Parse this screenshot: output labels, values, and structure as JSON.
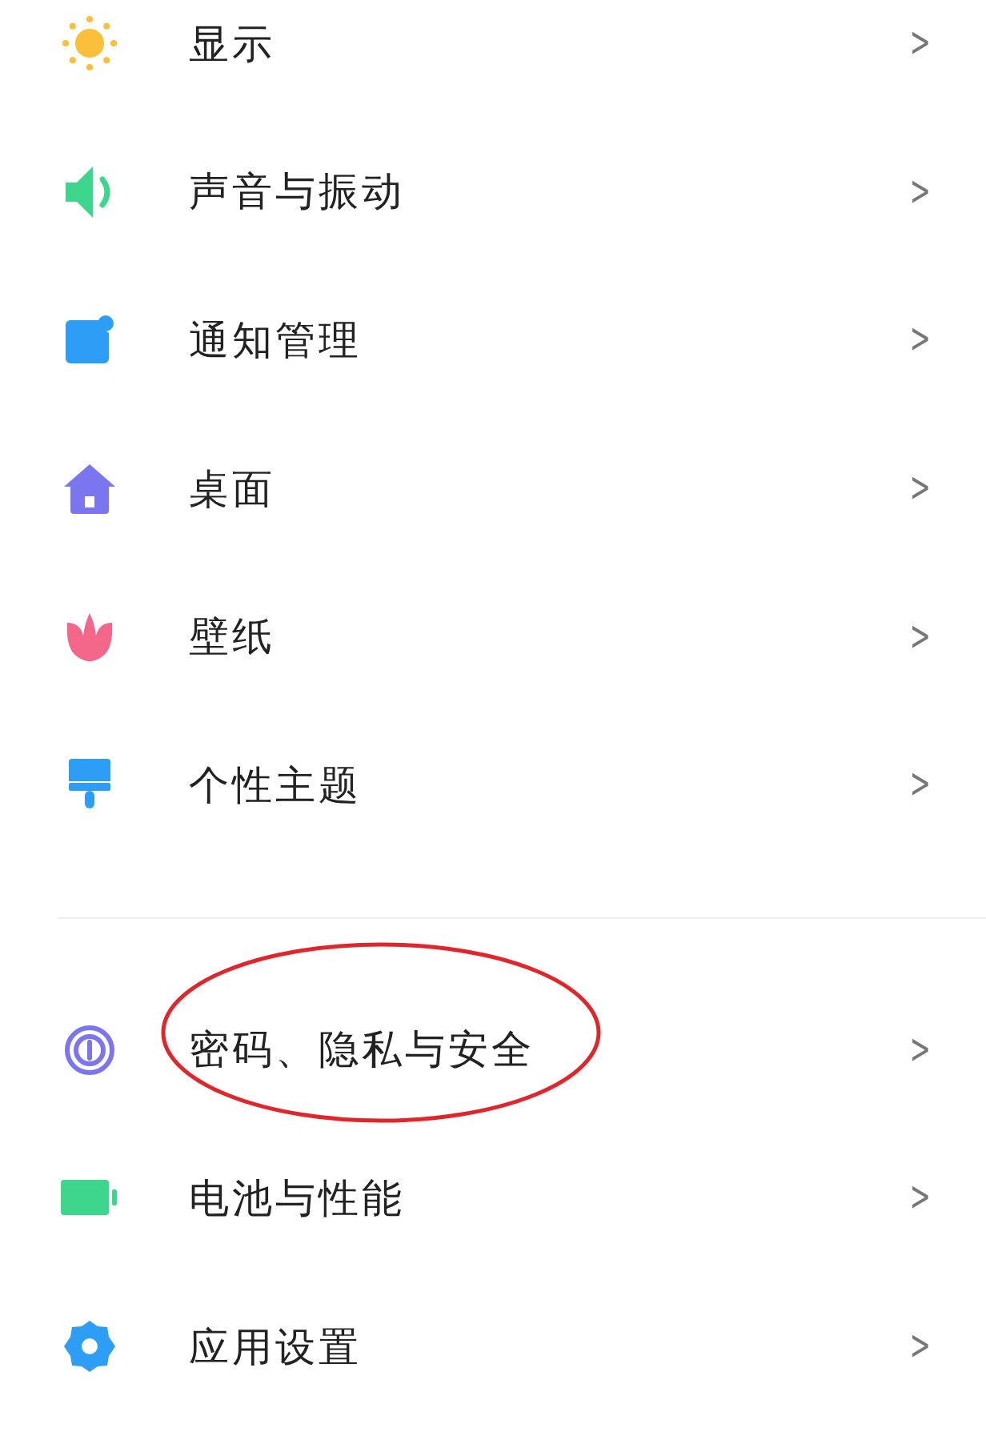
{
  "groups": [
    {
      "items": [
        {
          "kind": "sun",
          "label": "显示",
          "chevron": ">",
          "highlighted": false
        },
        {
          "kind": "speaker",
          "label": "声音与振动",
          "chevron": ">",
          "highlighted": false
        },
        {
          "kind": "notification",
          "label": "通知管理",
          "chevron": ">",
          "highlighted": false
        },
        {
          "kind": "home",
          "label": "桌面",
          "chevron": ">",
          "highlighted": false
        },
        {
          "kind": "tulip",
          "label": "壁纸",
          "chevron": ">",
          "highlighted": false
        },
        {
          "kind": "brush",
          "label": "个性主题",
          "chevron": ">",
          "highlighted": false
        }
      ]
    },
    {
      "items": [
        {
          "kind": "fingerprint",
          "label": "密码、隐私与安全",
          "chevron": ">",
          "highlighted": true
        },
        {
          "kind": "battery",
          "label": "电池与性能",
          "chevron": ">",
          "highlighted": false
        },
        {
          "kind": "gear",
          "label": "应用设置",
          "chevron": ">",
          "highlighted": false
        }
      ]
    }
  ]
}
